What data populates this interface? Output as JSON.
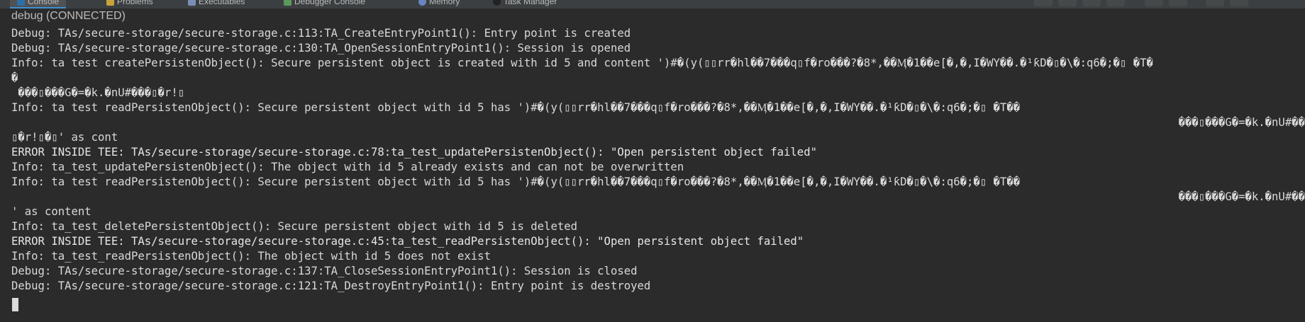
{
  "tabs": [
    {
      "label": "Console",
      "icon": "console-icon",
      "active": true
    },
    {
      "label": "Problems",
      "icon": "problems-icon",
      "active": false
    },
    {
      "label": "Executables",
      "icon": "executables-icon",
      "active": false
    },
    {
      "label": "Debugger Console",
      "icon": "debugger-console-icon",
      "active": false
    },
    {
      "label": "Memory",
      "icon": "memory-icon",
      "active": false
    },
    {
      "label": "Task Manager",
      "icon": "task-manager-icon",
      "active": false
    }
  ],
  "console": {
    "title": "debug (CONNECTED)",
    "lines": [
      "Debug: TAs/secure-storage/secure-storage.c:113:TA_CreateEntryPoint1(): Entry point is created",
      "Debug: TAs/secure-storage/secure-storage.c:130:TA_OpenSessionEntryPoint1(): Session is opened",
      "Info: ta test createPersistenObject(): Secure persistent object is created with id 5 and content ')#�(y(▯▯rr�hl��7���q▯f�ro���?�8*,��Ӎ�1��e[�,�,I�WY��.�¹ƙD�▯�\\�:q6�;�▯ �T�",
      "�",
      " ���▯���G�=�k.�nU#���▯�r!▯",
      "Info: ta test readPersistenObject(): Secure persistent object with id 5 has ')#�(y(▯▯rr�hl��7���q▯f�ro���?�8*,��Ӎ�1��e[�,�,I�WY��.�¹ƙD�▯�\\�:q6�;�▯ �T��",
      "▯�r!▯�▯' as cont",
      "ERROR INSIDE TEE: TAs/secure-storage/secure-storage.c:78:ta_test_updatePersistenObject(): \"Open persistent object failed\"",
      "Info: ta_test_updatePersistenObject(): The object with id 5 already exists and can not be overwritten",
      "Info: ta test readPersistenObject(): Secure persistent object with id 5 has ')#�(y(▯▯rr�hl��7���q▯f�ro���?�8*,��Ӎ�1��e[�,�,I�WY��.�¹ƙD�▯�\\�:q6�;�▯ �T��",
      "' as content",
      "Info: ta_test_deletePersistentObject(): Secure persistent object with id 5 is deleted",
      "ERROR INSIDE TEE: TAs/secure-storage/secure-storage.c:45:ta_test_readPersistenObject(): \"Open persistent object failed\"",
      "Info: ta_test_readPersistenObject(): The object with id 5 does not exist",
      "Debug: TAs/secure-storage/secure-storage.c:137:TA_CloseSessionEntryPoint1(): Session is closed",
      "Debug: TAs/secure-storage/secure-storage.c:121:TA_DestroyEntryPoint1(): Entry point is destroyed"
    ],
    "right_fragments": [
      "���▯���G�=�k.�nU#��",
      "���▯���G�=�k.�nU#��"
    ]
  },
  "colors": {
    "background": "#2b2b2b",
    "text": "#d8d8d8",
    "title": "#bbbbbb",
    "tab_accent": "#3d8fd1"
  }
}
